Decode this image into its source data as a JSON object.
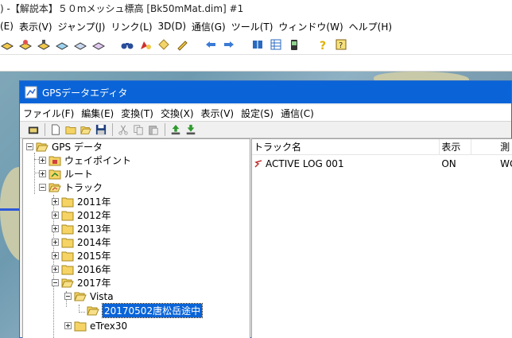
{
  "main_window": {
    "title": ") -【解説本】５０mメッシュ標高 [Bk50mMat.dim] #1",
    "menu": [
      "(E)",
      "表示(V)",
      "ジャンプ(J)",
      "リンク(L)",
      "3D(D)",
      "通信(G)",
      "ツール(T)",
      "ウィンドウ(W)",
      "ヘルプ(H)"
    ]
  },
  "gps_editor": {
    "title": "GPSデータエディタ",
    "menu": [
      "ファイル(F)",
      "編集(E)",
      "変換(T)",
      "交換(X)",
      "表示(V)",
      "設定(S)",
      "通信(C)"
    ],
    "tree": {
      "root": "GPS データ",
      "waypoints": "ウェイポイント",
      "routes": "ルート",
      "tracks": "トラック",
      "years": [
        "2011年",
        "2012年",
        "2013年",
        "2014年",
        "2015年",
        "2016年",
        "2017年"
      ],
      "vista": "Vista",
      "selected_track": "20170502唐松岳途中",
      "etrex": "eTrex30"
    },
    "list": {
      "columns": [
        "トラック名",
        "表示",
        "測"
      ],
      "rows": [
        {
          "name": "ACTIVE LOG 001",
          "display": "ON",
          "datum": "WG"
        }
      ]
    }
  },
  "colors": {
    "dialog_title_bar": "#0a64d8",
    "selection": "#0a64d8",
    "folder": "#f5d365"
  }
}
